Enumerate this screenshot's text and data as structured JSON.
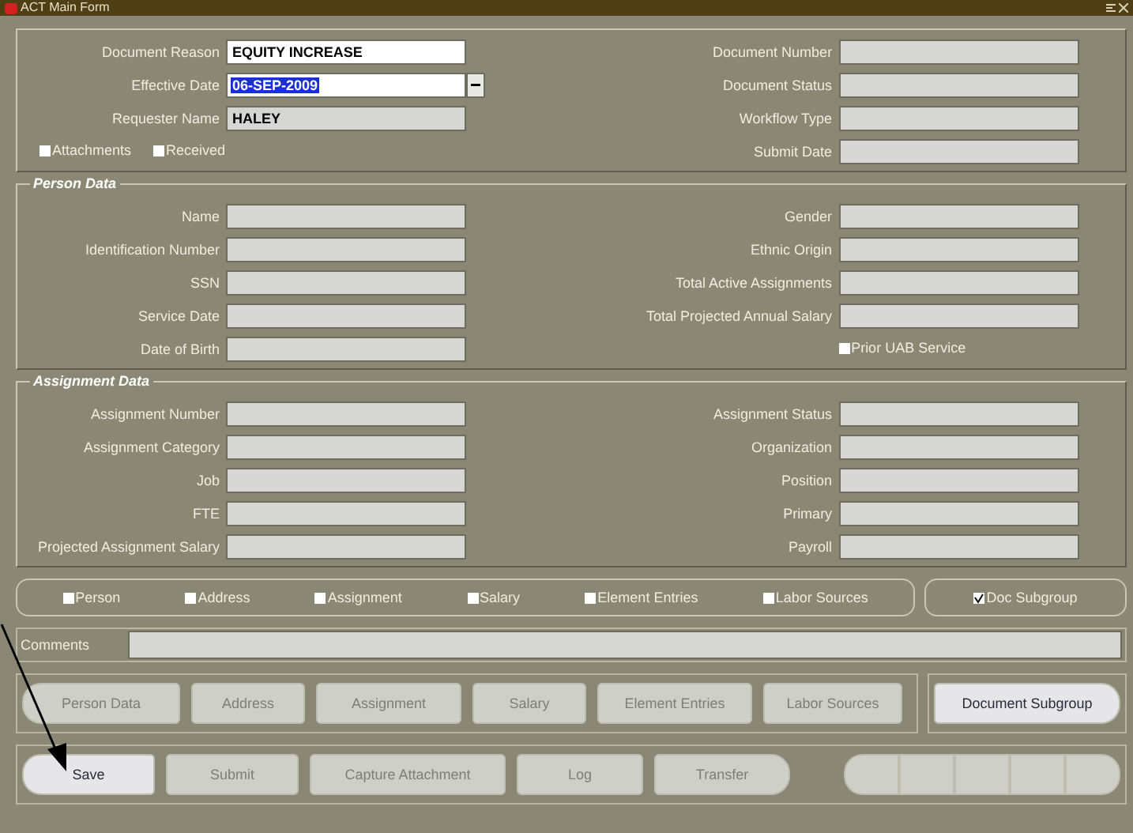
{
  "window": {
    "title": "ACT Main Form"
  },
  "header": {
    "left": [
      {
        "label": "Document Reason",
        "value": "EQUITY INCREASE",
        "kind": "editable",
        "selected": false
      },
      {
        "label": "Effective Date",
        "value": "06-SEP-2009",
        "kind": "date",
        "selected": true
      },
      {
        "label": "Requester Name",
        "value": "HALEY",
        "kind": "readonly",
        "selected": false
      }
    ],
    "checkboxes": [
      {
        "label": "Attachments",
        "checked": false
      },
      {
        "label": "Received",
        "checked": false
      }
    ],
    "right": [
      {
        "label": "Document Number"
      },
      {
        "label": "Document Status"
      },
      {
        "label": "Workflow Type"
      },
      {
        "label": "Submit Date"
      }
    ]
  },
  "person_data": {
    "title": "Person Data",
    "left": [
      {
        "label": "Name"
      },
      {
        "label": "Identification Number"
      },
      {
        "label": "SSN"
      },
      {
        "label": "Service Date"
      },
      {
        "label": "Date of Birth"
      }
    ],
    "right": [
      {
        "label": "Gender"
      },
      {
        "label": "Ethnic Origin"
      },
      {
        "label": "Total Active Assignments"
      },
      {
        "label": "Total Projected Annual Salary"
      }
    ],
    "checkboxes": [
      {
        "label": "Prior UAB Service",
        "checked": false
      }
    ]
  },
  "assignment_data": {
    "title": "Assignment Data",
    "left": [
      {
        "label": "Assignment Number"
      },
      {
        "label": "Assignment Category"
      },
      {
        "label": "Job"
      },
      {
        "label": "FTE"
      },
      {
        "label": "Projected Assignment Salary"
      }
    ],
    "right": [
      {
        "label": "Assignment Status"
      },
      {
        "label": "Organization"
      },
      {
        "label": "Position"
      },
      {
        "label": "Primary"
      },
      {
        "label": "Payroll"
      }
    ]
  },
  "section_checkboxes": [
    {
      "label": "Person",
      "checked": false
    },
    {
      "label": "Address",
      "checked": false
    },
    {
      "label": "Assignment",
      "checked": false
    },
    {
      "label": "Salary",
      "checked": false
    },
    {
      "label": "Element Entries",
      "checked": false
    },
    {
      "label": "Labor Sources",
      "checked": false
    }
  ],
  "subgroup_checkbox": {
    "label": "Doc Subgroup",
    "checked": true
  },
  "comments": {
    "label": "Comments"
  },
  "section_buttons": [
    {
      "label": "Person Data",
      "disabled": true
    },
    {
      "label": "Address",
      "disabled": true
    },
    {
      "label": "Assignment",
      "disabled": true
    },
    {
      "label": "Salary",
      "disabled": true
    },
    {
      "label": "Element Entries",
      "disabled": true
    },
    {
      "label": "Labor Sources",
      "disabled": true
    }
  ],
  "subgroup_button": {
    "label": "Document Subgroup",
    "disabled": false
  },
  "action_buttons": [
    {
      "label": "Save",
      "disabled": false
    },
    {
      "label": "Submit",
      "disabled": true
    },
    {
      "label": "Capture Attachment",
      "disabled": true
    },
    {
      "label": "Log",
      "disabled": true
    },
    {
      "label": "Transfer",
      "disabled": true
    }
  ],
  "nav_buttons": [
    {
      "disabled": true
    },
    {
      "disabled": true
    },
    {
      "disabled": true
    },
    {
      "disabled": true
    },
    {
      "disabled": true
    }
  ]
}
